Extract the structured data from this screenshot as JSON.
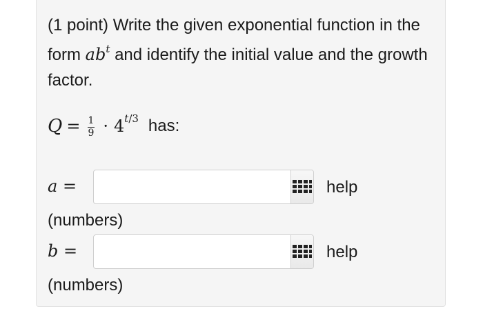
{
  "problem": {
    "prompt_prefix": "(1 point) Write the given exponential function in the form",
    "form_a": "a",
    "form_b": "b",
    "form_t": "t",
    "prompt_suffix": "and identify the initial value and the growth factor."
  },
  "equation": {
    "variable": "Q",
    "equals": "=",
    "frac_num": "1",
    "frac_den": "9",
    "dot": "·",
    "base": "4",
    "exp_t": "t",
    "exp_rest": "/3",
    "has": "has:"
  },
  "answers": [
    {
      "var": "a",
      "equals": "=",
      "value": "",
      "hint": "(numbers)",
      "help": "help"
    },
    {
      "var": "b",
      "equals": "=",
      "value": "",
      "hint": "(numbers)",
      "help": "help"
    }
  ],
  "icons": {
    "answer_tool": "grid-icon"
  },
  "colors": {
    "card_bg": "#f5f5f5",
    "border": "#cfcfcf"
  }
}
